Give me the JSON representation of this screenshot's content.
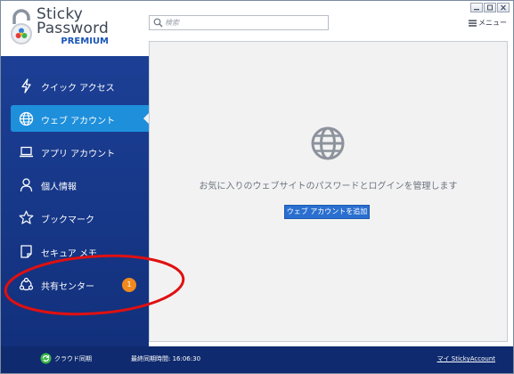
{
  "app": {
    "logo_line1": "Sticky",
    "logo_line2": "Password",
    "logo_line3": "PREMIUM"
  },
  "search": {
    "placeholder": "検索"
  },
  "header": {
    "menu_label": "メニュー"
  },
  "sidebar": {
    "items": [
      {
        "label": "クイック アクセス",
        "icon": "lightning-icon"
      },
      {
        "label": "ウェブ アカウント",
        "icon": "globe-icon",
        "active": true
      },
      {
        "label": "アプリ アカウント",
        "icon": "laptop-icon"
      },
      {
        "label": "個人情報",
        "icon": "person-icon"
      },
      {
        "label": "ブックマーク",
        "icon": "star-icon"
      },
      {
        "label": "セキュア メモ",
        "icon": "note-icon"
      },
      {
        "label": "共有センター",
        "icon": "share-icon",
        "badge": "1"
      }
    ]
  },
  "main": {
    "empty_message": "お気に入りのウェブサイトのパスワードとログインを管理します",
    "add_button": "ウェブ アカウントを追加"
  },
  "footer": {
    "sync_label": "クラウド同期",
    "last_sync": "最終同期時間: 16:06:30",
    "my_account": "マイ StickyAccount"
  },
  "colors": {
    "sidebar_bg": "#1c3f95",
    "active_item": "#1e8fdb",
    "badge": "#f08a1e",
    "button": "#2a6fd0",
    "annotation": "#e01010"
  }
}
